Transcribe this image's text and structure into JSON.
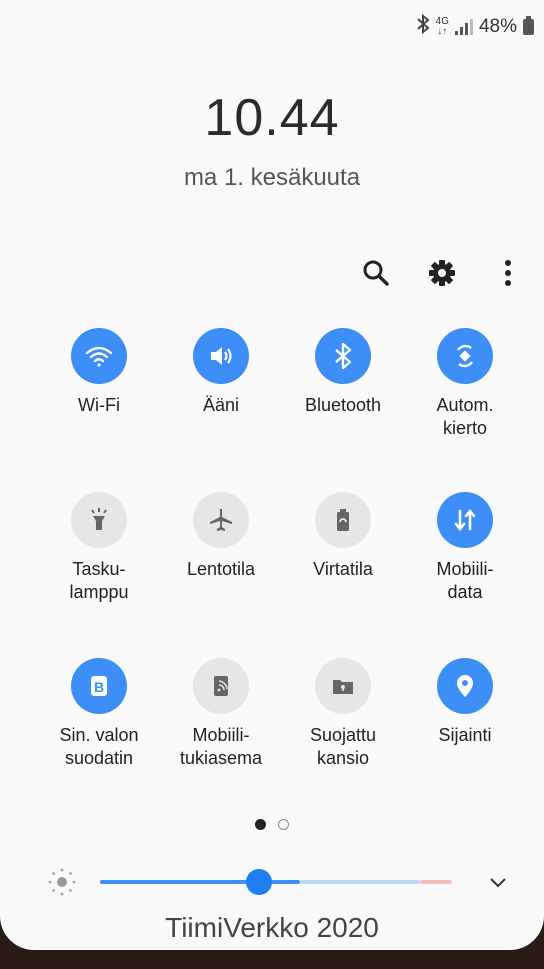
{
  "status_bar": {
    "network_type": "4G",
    "battery": "48%"
  },
  "clock": {
    "time": "10.44",
    "date": "ma 1. kesäkuuta"
  },
  "tiles": [
    {
      "label": "Wi-Fi",
      "state": "on",
      "icon": "wifi-icon"
    },
    {
      "label": "Ääni",
      "state": "on",
      "icon": "volume-icon"
    },
    {
      "label": "Bluetooth",
      "state": "on",
      "icon": "bluetooth-icon"
    },
    {
      "label": "Autom.\nkierto",
      "state": "on",
      "icon": "auto-rotate-icon"
    },
    {
      "label": "Tasku-\nlamppu",
      "state": "off",
      "icon": "flashlight-icon"
    },
    {
      "label": "Lentotila",
      "state": "off",
      "icon": "airplane-icon"
    },
    {
      "label": "Virtatila",
      "state": "off",
      "icon": "battery-saver-icon"
    },
    {
      "label": "Mobiili-\ndata",
      "state": "on",
      "icon": "mobile-data-icon"
    },
    {
      "label": "Sin. valon\nsuodatin",
      "state": "on",
      "icon": "blue-light-filter-icon"
    },
    {
      "label": "Mobiili-\ntukiasema",
      "state": "off",
      "icon": "hotspot-icon"
    },
    {
      "label": "Suojattu\nkansio",
      "state": "off",
      "icon": "secure-folder-icon"
    },
    {
      "label": "Sijainti",
      "state": "on",
      "icon": "location-icon"
    }
  ],
  "pagination": {
    "current": 1,
    "total": 2
  },
  "brightness": {
    "level": 0.42
  },
  "watermark": "TiimiVerkko 2020",
  "colors": {
    "accent": "#3e8ef7",
    "tile_off": "#e6e6e6",
    "panel_bg": "#fafafa"
  }
}
